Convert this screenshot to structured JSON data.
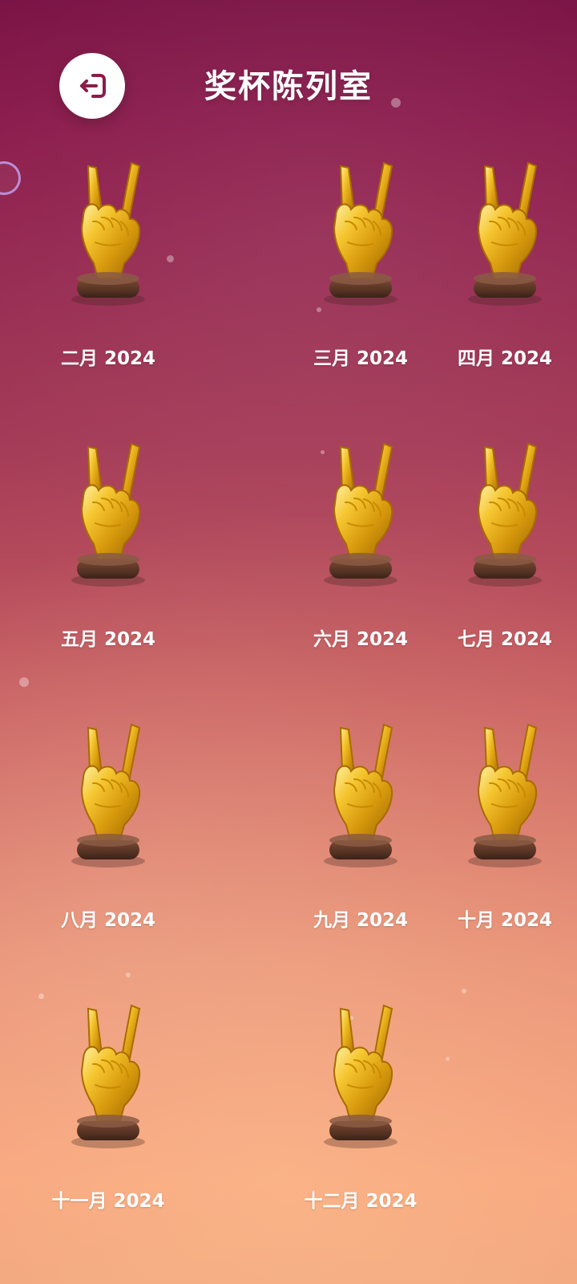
{
  "header": {
    "title": "奖杯陈列室",
    "back_icon": "exit-icon"
  },
  "trophies": [
    {
      "label": "二月 2024",
      "icon": "peace-hand-trophy-icon"
    },
    {
      "label": "三月 2024",
      "icon": "peace-hand-trophy-icon"
    },
    {
      "label": "四月 2024",
      "icon": "peace-hand-trophy-icon"
    },
    {
      "label": "五月 2024",
      "icon": "peace-hand-trophy-icon"
    },
    {
      "label": "六月 2024",
      "icon": "peace-hand-trophy-icon"
    },
    {
      "label": "七月 2024",
      "icon": "peace-hand-trophy-icon"
    },
    {
      "label": "八月 2024",
      "icon": "peace-hand-trophy-icon"
    },
    {
      "label": "九月 2024",
      "icon": "peace-hand-trophy-icon"
    },
    {
      "label": "十月 2024",
      "icon": "peace-hand-trophy-icon"
    },
    {
      "label": "十一月 2024",
      "icon": "peace-hand-trophy-icon"
    },
    {
      "label": "十二月 2024",
      "icon": "peace-hand-trophy-icon"
    }
  ],
  "colors": {
    "background_top": "#7a1244",
    "background_bottom": "#f7a07a",
    "text": "#ffffff",
    "trophy_gold": "#f2c230",
    "trophy_base": "#5b3526"
  }
}
